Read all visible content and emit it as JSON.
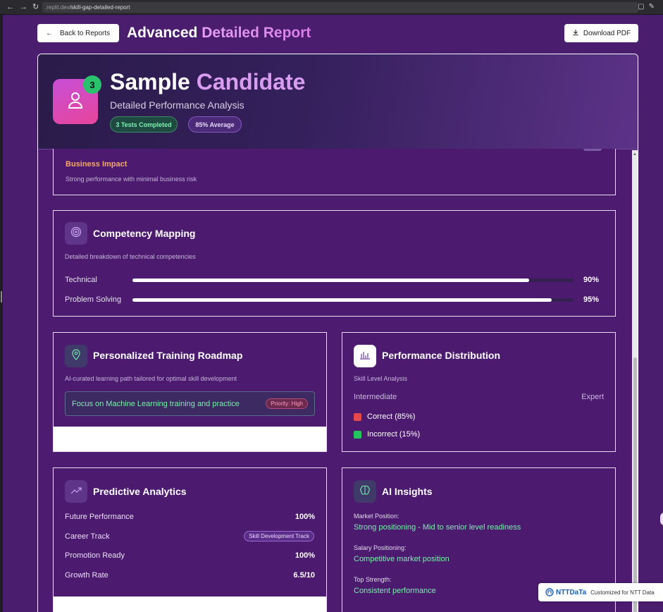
{
  "browser": {
    "url_prefix": ".replit.dev",
    "url_path": "/skill-gap-detailed-report"
  },
  "header": {
    "back_label": "Back to Reports",
    "title_plain": "Advanced",
    "title_highlight": "Detailed Report",
    "download_label": "Download PDF"
  },
  "candidate": {
    "name_plain": "Sample",
    "name_highlight": "Candidate",
    "badge_count": "3",
    "subtitle": "Detailed Performance Analysis",
    "pill_tests": "3 Tests Completed",
    "pill_average": "85% Average"
  },
  "business_impact": {
    "title": "Business Impact",
    "description": "Strong performance with minimal business risk"
  },
  "competency": {
    "title": "Competency Mapping",
    "description": "Detailed breakdown of technical competencies",
    "items": [
      {
        "label": "Technical",
        "value": "90%",
        "fraction": 0.9
      },
      {
        "label": "Problem Solving",
        "value": "95%",
        "fraction": 0.95
      }
    ]
  },
  "training": {
    "title": "Personalized Training Roadmap",
    "description": "AI-curated learning path tailored for optimal skill development",
    "focus_text": "Focus on Machine Learning training and practice",
    "priority_label": "Priority: High"
  },
  "distribution": {
    "title": "Performance Distribution",
    "subtitle": "Skill Level Analysis",
    "level_left": "Intermediate",
    "level_right": "Expert",
    "legend": [
      {
        "label": "Correct (85%)",
        "color": "#e5484d"
      },
      {
        "label": "Incorrect (15%)",
        "color": "#22c55e"
      }
    ]
  },
  "predictive": {
    "title": "Predictive Analytics",
    "rows": [
      {
        "label": "Future Performance",
        "value": "100%"
      },
      {
        "label": "Career Track",
        "value": "Skill Development Track"
      },
      {
        "label": "Promotion Ready",
        "value": "100%"
      },
      {
        "label": "Growth Rate",
        "value": "6.5/10"
      }
    ]
  },
  "insights": {
    "title": "AI Insights",
    "items": [
      {
        "label": "Market Position:",
        "value": "Strong positioning - Mid to senior level readiness"
      },
      {
        "label": "Salary Positioning:",
        "value": "Competitive market position"
      },
      {
        "label": "Top Strength:",
        "value": "Consistent performance"
      }
    ]
  },
  "branding": {
    "logo_text": "NTTDaTa",
    "customized_text": "Customized for NTT Data"
  }
}
